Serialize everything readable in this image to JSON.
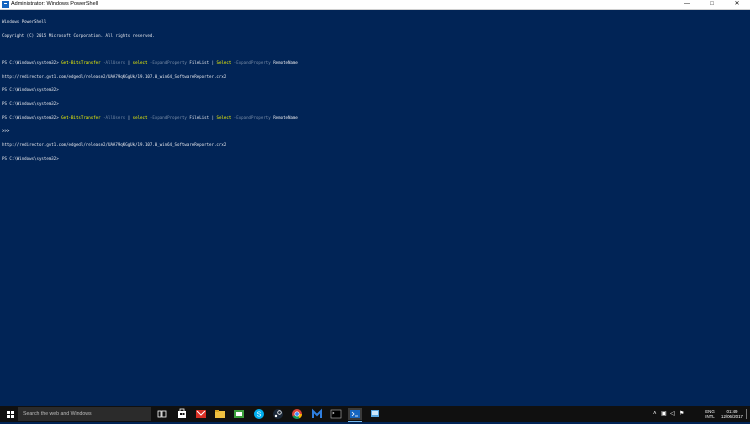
{
  "window": {
    "title": "Administrator: Windows PowerShell",
    "minimize_glyph": "—",
    "maximize_glyph": "□",
    "close_glyph": "✕"
  },
  "console": {
    "header_1": "Windows PowerShell",
    "header_2": "Copyright (C) 2015 Microsoft Corporation. All rights reserved.",
    "prompt": "PS C:\\Windows\\system32>",
    "cmd1": {
      "cmdlet": "Get-BitsTransfer",
      "param_allusers": "-AllUsers",
      "pipe": "|",
      "select": "select",
      "param_expand": "-ExpandProperty",
      "arg_filelist": "FileList",
      "select2": "Select",
      "arg_remotename": "RemoteName"
    },
    "output1": "http://redirector.gvt1.com/edgedl/release2/UAA79qKGgUk/19.107.0_win64_SoftwareReporter.crx2",
    "output2_prefix": ">>>",
    "output2": "http://redirector.gvt1.com/edgedl/release2/UAA79qKGgUk/19.107.0_win64_SoftwareReporter.crx2"
  },
  "taskbar": {
    "search_placeholder": "Search the web and Windows",
    "language": "ENG",
    "locale": "INTL",
    "time": "01:49",
    "date": "12/06/2017"
  },
  "icons": {
    "start": "windows-logo",
    "task_view": "task-view",
    "store": "store",
    "gmail": "gmail",
    "file_explorer": "file-explorer",
    "skype": "skype",
    "edge": "edge",
    "steam": "steam",
    "chrome": "chrome",
    "malwarebytes": "malwarebytes",
    "cmd": "command-prompt",
    "powershell": "powershell",
    "network": "network"
  }
}
